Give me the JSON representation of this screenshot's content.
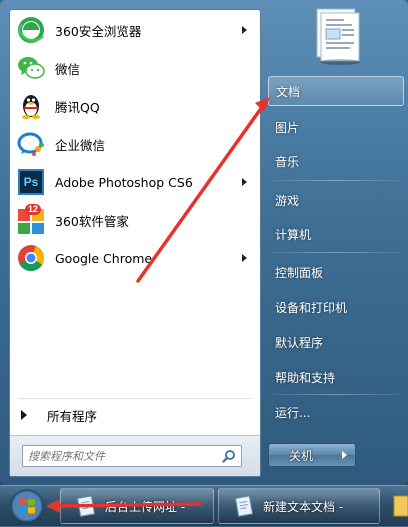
{
  "programs": [
    {
      "label": "360安全浏览器",
      "icon": "360-browser-icon",
      "has_submenu": true
    },
    {
      "label": "微信",
      "icon": "wechat-icon",
      "has_submenu": false
    },
    {
      "label": "腾讯QQ",
      "icon": "qq-penguin-icon",
      "has_submenu": false
    },
    {
      "label": "企业微信",
      "icon": "wecom-icon",
      "has_submenu": false
    },
    {
      "label": "Adobe Photoshop CS6",
      "icon": "photoshop-icon",
      "has_submenu": true
    },
    {
      "label": "360软件管家",
      "icon": "360-software-manager-icon",
      "has_submenu": false
    },
    {
      "label": "Google Chrome",
      "icon": "chrome-icon",
      "has_submenu": true
    }
  ],
  "badge_360": "12",
  "ps_icon_text": "Ps",
  "all_programs": "所有程序",
  "search": {
    "placeholder": "搜索程序和文件"
  },
  "right_items": [
    {
      "label": "文档",
      "highlighted": true
    },
    {
      "label": "图片"
    },
    {
      "label": "音乐"
    },
    {
      "label": "游戏"
    },
    {
      "label": "计算机"
    },
    {
      "label": "控制面板"
    },
    {
      "label": "设备和打印机"
    },
    {
      "label": "默认程序"
    },
    {
      "label": "帮助和支持"
    },
    {
      "label": "运行..."
    }
  ],
  "shutdown": {
    "label": "关机"
  },
  "taskbar": {
    "buttons": [
      {
        "label": "后台上传网址 -",
        "icon": "notepad-icon"
      },
      {
        "label": "新建文本文档 -",
        "icon": "notepad-icon"
      }
    ]
  },
  "colors": {
    "annotation_arrow": "#e8322e",
    "menu_blue": "#3f6f95"
  }
}
